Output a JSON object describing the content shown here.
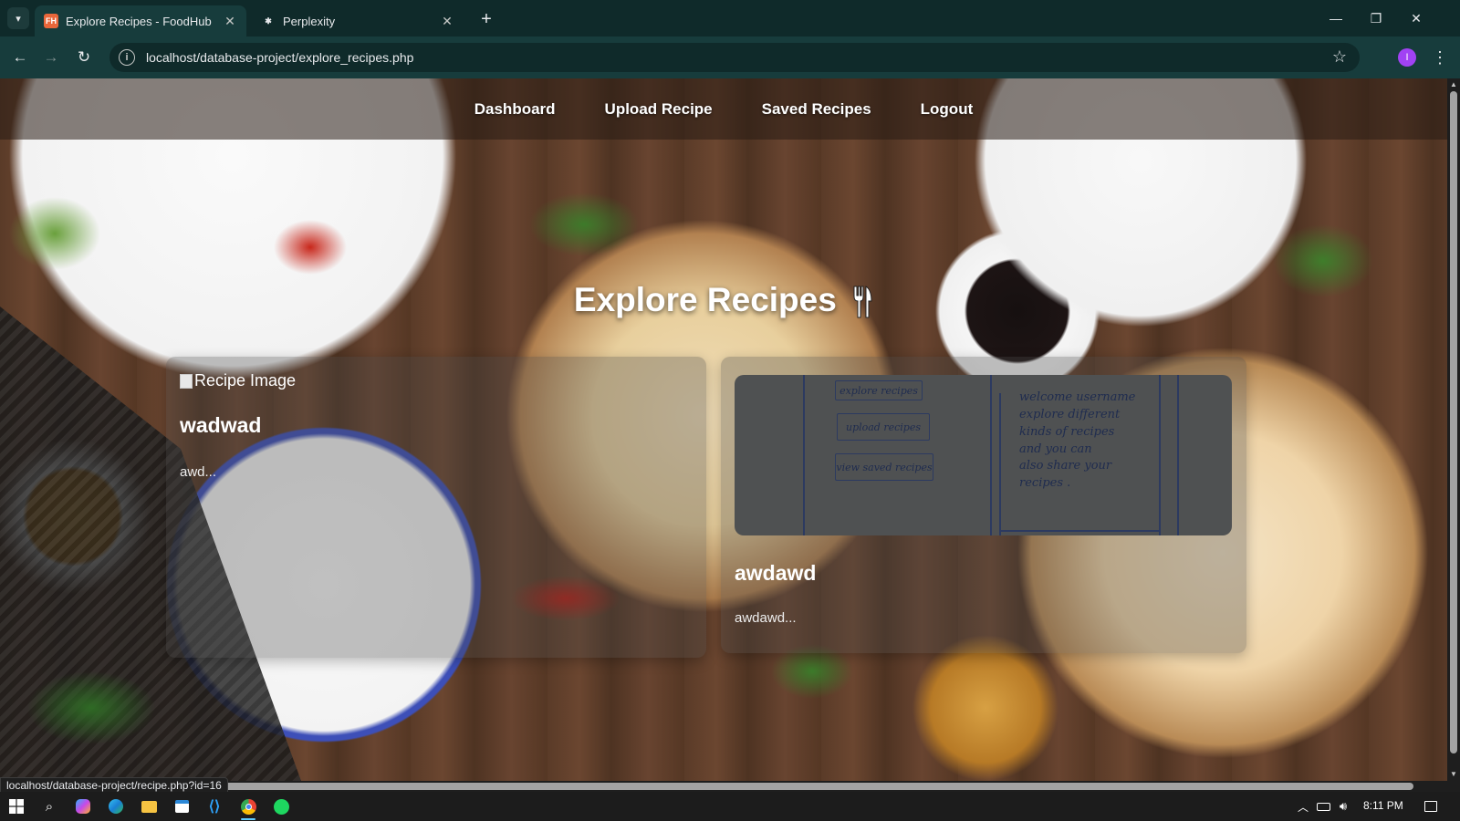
{
  "browser": {
    "tabs": [
      {
        "title": "Explore Recipes - FoodHub",
        "active": true
      },
      {
        "title": "Perplexity",
        "active": false
      }
    ],
    "url": "localhost/database-project/explore_recipes.php",
    "profile_initial": "I",
    "status_url": "localhost/database-project/recipe.php?id=16"
  },
  "nav": {
    "links": [
      "Dashboard",
      "Upload Recipe",
      "Saved Recipes",
      "Logout"
    ]
  },
  "page": {
    "title": "Explore Recipes"
  },
  "recipes": [
    {
      "image_alt": "Recipe Image",
      "title": "wadwad",
      "description": "awd..."
    },
    {
      "title": "awdawd",
      "description": "awdawd..."
    }
  ],
  "sketch": {
    "buttons": [
      "explore recipes",
      "upload recipes",
      "view saved recipes"
    ],
    "note": "welcome username\nexplore different\nkinds of recipes\nand you can\nalso share your\nrecipes ."
  },
  "taskbar": {
    "time": "8:11 PM"
  },
  "colors": {
    "tab_bg": "#0f2a2a",
    "toolbar_bg": "#173c3c",
    "profile": "#a142f4",
    "favicon": "#e8663a"
  }
}
